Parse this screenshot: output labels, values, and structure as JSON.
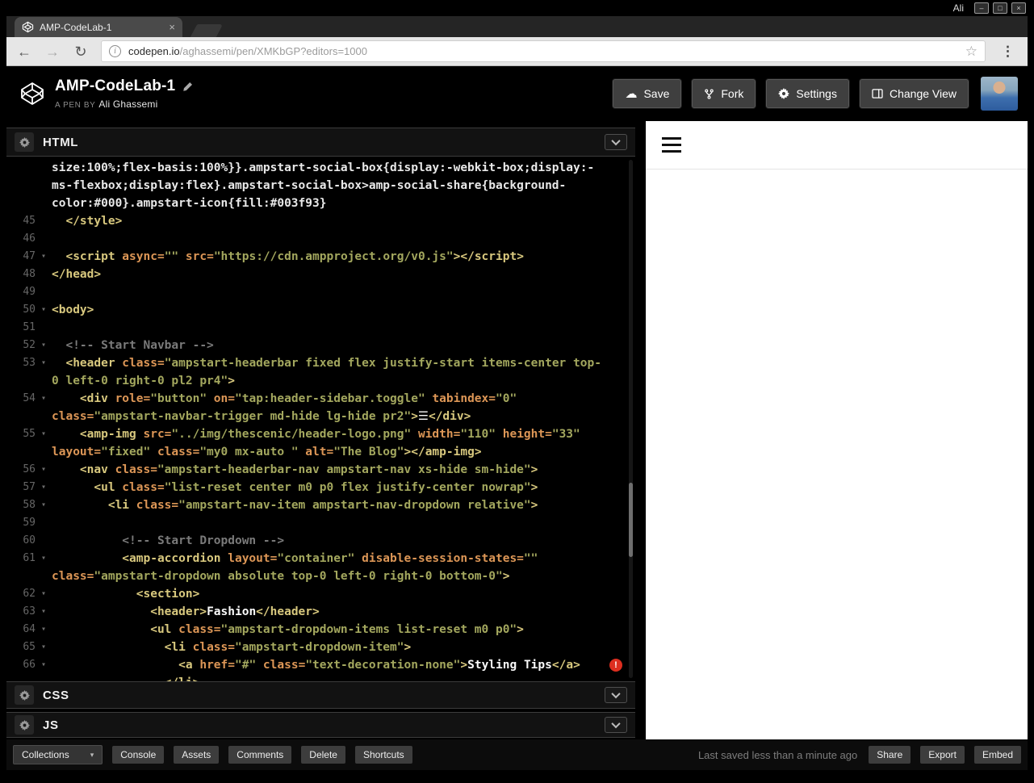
{
  "browser": {
    "os_user": "Ali",
    "window_minimize": "–",
    "window_maximize": "□",
    "window_close": "×",
    "tab_title": "AMP-CodeLab-1",
    "tab_close": "×",
    "url_domain": "codepen.io",
    "url_path": "/aghassemi/pen/XMKbGP?editors=1000"
  },
  "header": {
    "title": "AMP-CodeLab-1",
    "pen_by_label": "A PEN BY",
    "author": "Ali Ghassemi",
    "save_label": "Save",
    "fork_label": "Fork",
    "settings_label": "Settings",
    "change_view_label": "Change View"
  },
  "editor": {
    "sections": {
      "html": "HTML",
      "css": "CSS",
      "js": "JS"
    },
    "colors": {
      "tag": "#d8c87e",
      "attr": "#dc9656",
      "string": "#a3a75e",
      "text": "#fafafa",
      "comment": "#7a7a7a",
      "css_text": "#e8e8e8",
      "error": "#dd2e1f",
      "line_number": "#666666"
    },
    "lines": [
      {
        "num": "",
        "seg": [
          [
            "css",
            "size:100%;flex-basis:100%}}.ampstart-social-box{display:-webkit-box;display:-"
          ]
        ]
      },
      {
        "num": "",
        "seg": [
          [
            "css",
            "ms-flexbox;display:flex}.ampstart-social-box>amp-social-share{background-"
          ]
        ]
      },
      {
        "num": "",
        "seg": [
          [
            "css",
            "color:#000}.ampstart-icon{fill:#003f93}"
          ]
        ]
      },
      {
        "num": "45",
        "seg": [
          [
            "tag",
            "  </style>"
          ]
        ]
      },
      {
        "num": "46",
        "seg": []
      },
      {
        "num": "47",
        "fold": true,
        "seg": [
          [
            "tag",
            "  <script"
          ],
          [
            "attr",
            " async="
          ],
          [
            "str",
            "\"\""
          ],
          [
            "attr",
            " src="
          ],
          [
            "str",
            "\"https://cdn.ampproject.org/v0.js\""
          ],
          [
            "tag",
            "></script>"
          ]
        ]
      },
      {
        "num": "48",
        "seg": [
          [
            "tag",
            "</head>"
          ]
        ]
      },
      {
        "num": "49",
        "seg": []
      },
      {
        "num": "50",
        "fold": true,
        "seg": [
          [
            "tag",
            "<body>"
          ]
        ]
      },
      {
        "num": "51",
        "seg": []
      },
      {
        "num": "52",
        "fold": true,
        "seg": [
          [
            "com",
            "  <!-- Start Navbar -->"
          ]
        ]
      },
      {
        "num": "53",
        "fold": true,
        "seg": [
          [
            "tag",
            "  <header"
          ],
          [
            "attr",
            " class="
          ],
          [
            "str",
            "\"ampstart-headerbar fixed flex justify-start items-center top-"
          ]
        ]
      },
      {
        "num": "",
        "seg": [
          [
            "str",
            "0 left-0 right-0 pl2 pr4\""
          ],
          [
            "tag",
            ">"
          ]
        ]
      },
      {
        "num": "54",
        "fold": true,
        "seg": [
          [
            "tag",
            "    <div"
          ],
          [
            "attr",
            " role="
          ],
          [
            "str",
            "\"button\""
          ],
          [
            "attr",
            " on="
          ],
          [
            "str",
            "\"tap:header-sidebar.toggle\""
          ],
          [
            "attr",
            " tabindex="
          ],
          [
            "str",
            "\"0\""
          ]
        ]
      },
      {
        "num": "",
        "seg": [
          [
            "attr",
            "class="
          ],
          [
            "str",
            "\"ampstart-navbar-trigger md-hide lg-hide pr2\""
          ],
          [
            "tag",
            ">"
          ],
          [
            "txt",
            "☰"
          ],
          [
            "tag",
            "</div>"
          ]
        ]
      },
      {
        "num": "55",
        "fold": true,
        "seg": [
          [
            "tag",
            "    <amp-img"
          ],
          [
            "attr",
            " src="
          ],
          [
            "str",
            "\"../img/thescenic/header-logo.png\""
          ],
          [
            "attr",
            " width="
          ],
          [
            "str",
            "\"110\""
          ],
          [
            "attr",
            " height="
          ],
          [
            "str",
            "\"33\""
          ]
        ]
      },
      {
        "num": "",
        "seg": [
          [
            "attr",
            "layout="
          ],
          [
            "str",
            "\"fixed\""
          ],
          [
            "attr",
            " class="
          ],
          [
            "str",
            "\"my0 mx-auto \""
          ],
          [
            "attr",
            " alt="
          ],
          [
            "str",
            "\"The Blog\""
          ],
          [
            "tag",
            "></amp-img>"
          ]
        ]
      },
      {
        "num": "56",
        "fold": true,
        "seg": [
          [
            "tag",
            "    <nav"
          ],
          [
            "attr",
            " class="
          ],
          [
            "str",
            "\"ampstart-headerbar-nav ampstart-nav xs-hide sm-hide\""
          ],
          [
            "tag",
            ">"
          ]
        ]
      },
      {
        "num": "57",
        "fold": true,
        "seg": [
          [
            "tag",
            "      <ul"
          ],
          [
            "attr",
            " class="
          ],
          [
            "str",
            "\"list-reset center m0 p0 flex justify-center nowrap\""
          ],
          [
            "tag",
            ">"
          ]
        ]
      },
      {
        "num": "58",
        "fold": true,
        "seg": [
          [
            "tag",
            "        <li"
          ],
          [
            "attr",
            " class="
          ],
          [
            "str",
            "\"ampstart-nav-item ampstart-nav-dropdown relative\""
          ],
          [
            "tag",
            ">"
          ]
        ]
      },
      {
        "num": "59",
        "seg": []
      },
      {
        "num": "60",
        "seg": [
          [
            "com",
            "          <!-- Start Dropdown -->"
          ]
        ]
      },
      {
        "num": "61",
        "fold": true,
        "seg": [
          [
            "tag",
            "          <amp-accordion"
          ],
          [
            "attr",
            " layout="
          ],
          [
            "str",
            "\"container\""
          ],
          [
            "attr",
            " disable-session-states="
          ],
          [
            "str",
            "\"\""
          ]
        ]
      },
      {
        "num": "",
        "seg": [
          [
            "attr",
            "class="
          ],
          [
            "str",
            "\"ampstart-dropdown absolute top-0 left-0 right-0 bottom-0\""
          ],
          [
            "tag",
            ">"
          ]
        ]
      },
      {
        "num": "62",
        "fold": true,
        "seg": [
          [
            "tag",
            "            <section>"
          ]
        ]
      },
      {
        "num": "63",
        "fold": true,
        "seg": [
          [
            "tag",
            "              <header>"
          ],
          [
            "txt",
            "Fashion"
          ],
          [
            "tag",
            "</header>"
          ]
        ]
      },
      {
        "num": "64",
        "fold": true,
        "seg": [
          [
            "tag",
            "              <ul"
          ],
          [
            "attr",
            " class="
          ],
          [
            "str",
            "\"ampstart-dropdown-items list-reset m0 p0\""
          ],
          [
            "tag",
            ">"
          ]
        ]
      },
      {
        "num": "65",
        "fold": true,
        "seg": [
          [
            "tag",
            "                <li"
          ],
          [
            "attr",
            " class="
          ],
          [
            "str",
            "\"ampstart-dropdown-item\""
          ],
          [
            "tag",
            ">"
          ]
        ]
      },
      {
        "num": "66",
        "fold": true,
        "error": true,
        "seg": [
          [
            "tag",
            "                  <a"
          ],
          [
            "attr",
            " href="
          ],
          [
            "str",
            "\"#\""
          ],
          [
            "attr",
            " class="
          ],
          [
            "str",
            "\"text-decoration-none\""
          ],
          [
            "tag",
            ">"
          ],
          [
            "txt",
            "Styling Tips"
          ],
          [
            "tag",
            "</a>"
          ]
        ]
      },
      {
        "num": "",
        "seg": [
          [
            "tag",
            "                </li>"
          ]
        ]
      }
    ]
  },
  "preview": {
    "hamburger_icon": "menu"
  },
  "footer": {
    "collections_label": "Collections",
    "console_label": "Console",
    "assets_label": "Assets",
    "comments_label": "Comments",
    "delete_label": "Delete",
    "shortcuts_label": "Shortcuts",
    "last_saved": "Last saved less than a minute ago",
    "share_label": "Share",
    "export_label": "Export",
    "embed_label": "Embed"
  }
}
